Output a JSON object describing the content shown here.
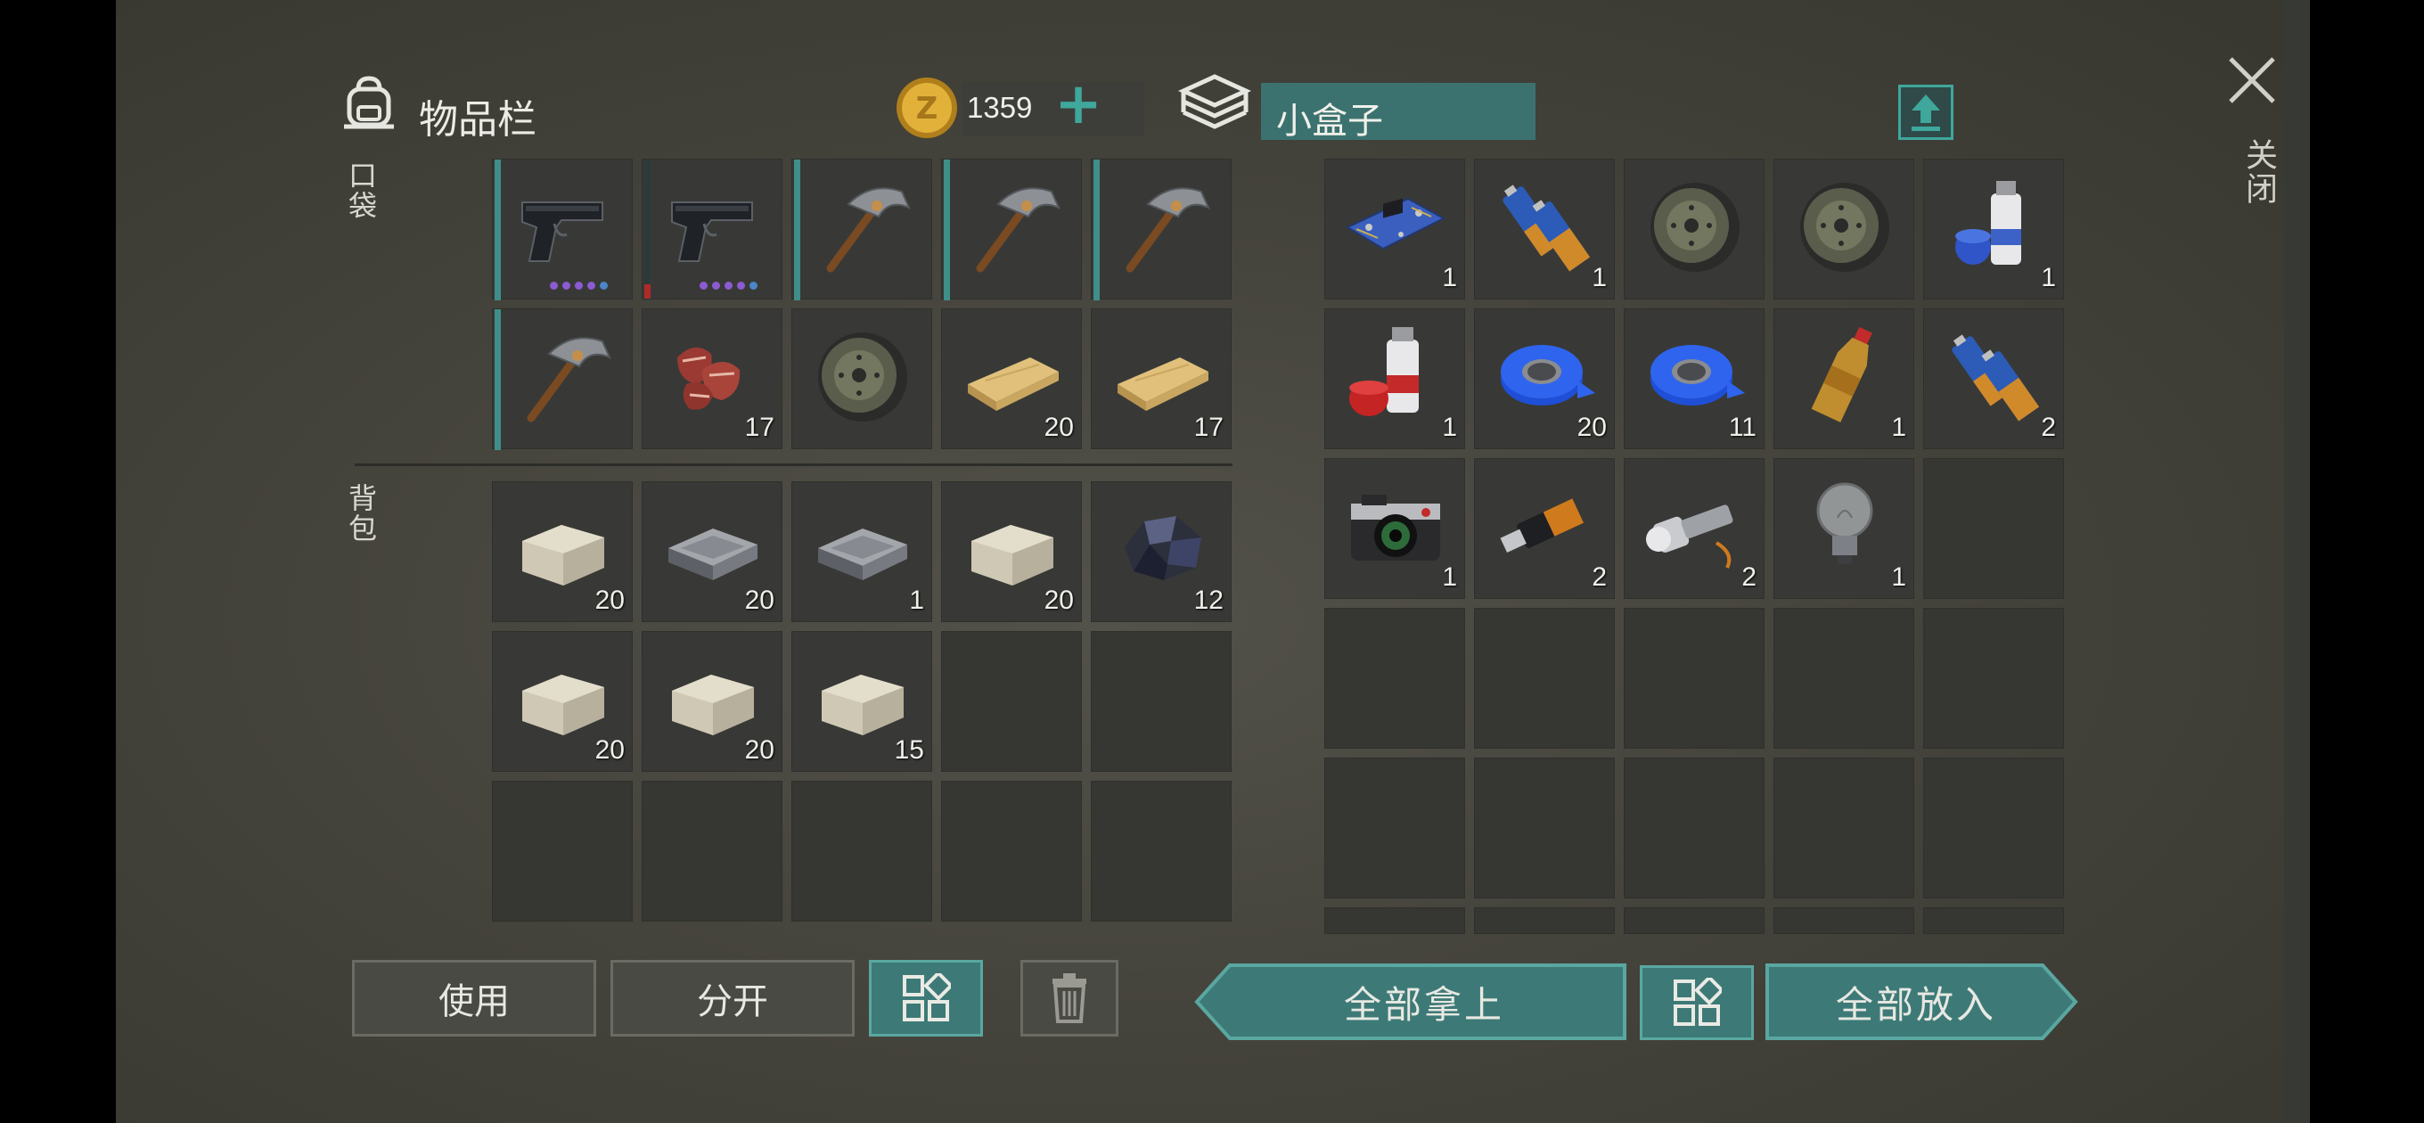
{
  "inventory": {
    "title": "物品栏",
    "pocket_label": "口袋",
    "backpack_label": "背包",
    "coins": "1359",
    "add_label": "+",
    "pocket_slots": [
      {
        "item": "pistol-icon",
        "count": "",
        "bar": "teal",
        "dots": 5
      },
      {
        "item": "pistol-icon",
        "count": "",
        "bar": "red",
        "dots": 5
      },
      {
        "item": "pickaxe-icon",
        "count": "",
        "bar": "teal",
        "dots": 0
      },
      {
        "item": "pickaxe-icon",
        "count": "",
        "bar": "teal",
        "dots": 0
      },
      {
        "item": "pickaxe-icon",
        "count": "",
        "bar": "teal",
        "dots": 0
      },
      {
        "item": "pickaxe-icon",
        "count": "",
        "bar": "teal",
        "dots": 0
      },
      {
        "item": "raw-meat-icon",
        "count": "17",
        "bar": "",
        "dots": 0
      },
      {
        "item": "tire-icon",
        "count": "",
        "bar": "",
        "dots": 0
      },
      {
        "item": "wood-plank-icon",
        "count": "20",
        "bar": "",
        "dots": 0
      },
      {
        "item": "wood-plank-icon",
        "count": "17",
        "bar": "",
        "dots": 0
      }
    ],
    "backpack_slots": [
      {
        "item": "stone-icon",
        "count": "20"
      },
      {
        "item": "iron-ingot-icon",
        "count": "20"
      },
      {
        "item": "iron-ingot-icon",
        "count": "1"
      },
      {
        "item": "stone-icon",
        "count": "20"
      },
      {
        "item": "iron-ore-icon",
        "count": "12"
      },
      {
        "item": "stone-icon",
        "count": "20"
      },
      {
        "item": "stone-icon",
        "count": "20"
      },
      {
        "item": "stone-icon",
        "count": "15"
      },
      {
        "item": "",
        "count": ""
      },
      {
        "item": "",
        "count": ""
      },
      {
        "item": "",
        "count": ""
      },
      {
        "item": "",
        "count": ""
      },
      {
        "item": "",
        "count": ""
      },
      {
        "item": "",
        "count": ""
      },
      {
        "item": "",
        "count": ""
      }
    ],
    "use_label": "使用",
    "split_label": "分开"
  },
  "container": {
    "title": "小盒子",
    "take_all_label": "全部拿上",
    "put_all_label": "全部放入",
    "slots": [
      {
        "item": "circuit-board-icon",
        "count": "1"
      },
      {
        "item": "batteries-icon",
        "count": "1"
      },
      {
        "item": "tire-icon",
        "count": ""
      },
      {
        "item": "tire-icon",
        "count": ""
      },
      {
        "item": "blue-spray-paint-icon",
        "count": "1"
      },
      {
        "item": "red-spray-paint-icon",
        "count": "1"
      },
      {
        "item": "blue-tape-icon",
        "count": "20"
      },
      {
        "item": "blue-tape-icon",
        "count": "11"
      },
      {
        "item": "soda-bottle-icon",
        "count": "1"
      },
      {
        "item": "batteries-icon",
        "count": "2"
      },
      {
        "item": "camera-icon",
        "count": "1"
      },
      {
        "item": "usb-drive-icon",
        "count": "2"
      },
      {
        "item": "flashlight-icon",
        "count": "2"
      },
      {
        "item": "light-bulb-icon",
        "count": "1"
      },
      {
        "item": "",
        "count": ""
      }
    ]
  },
  "close_label": "关闭",
  "colors": {
    "accent": "#3d7a77",
    "accent_border": "#5aa7a1",
    "slot_bg": "#383936",
    "durability": "#3f8e89",
    "rarity_dot": "#8c5ad1"
  }
}
